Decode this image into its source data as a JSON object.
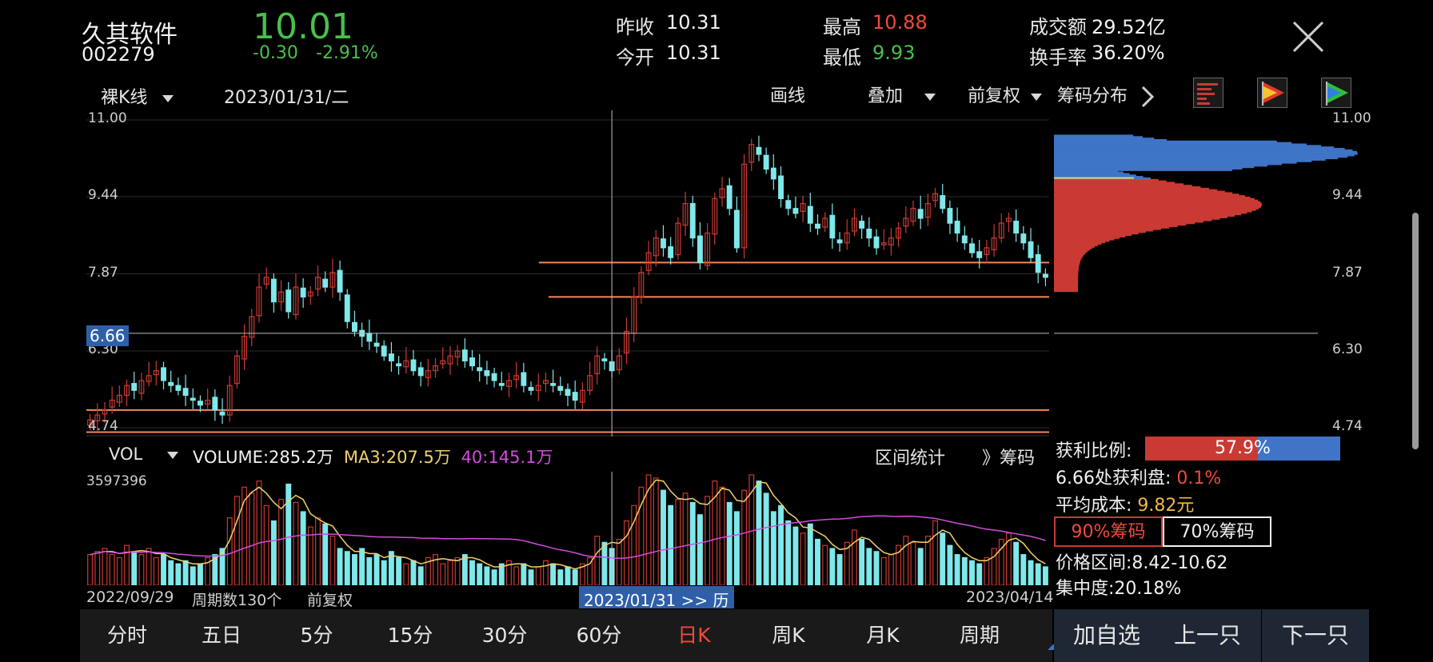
{
  "header": {
    "name": "久其软件",
    "code": "002279",
    "price": "10.01",
    "change": "-0.30",
    "change_pct": "-2.91%",
    "prev_close_label": "昨收",
    "prev_close": "10.31",
    "open_label": "今开",
    "open": "10.31",
    "high_label": "最高",
    "high": "10.88",
    "low_label": "最低",
    "low": "9.93",
    "amount_label": "成交额",
    "amount": "29.52亿",
    "turnover_label": "换手率",
    "turnover": "36.20%"
  },
  "toolbar": {
    "kline_type": "裸K线",
    "date": "2023/01/31/二",
    "draw": "画线",
    "overlay": "叠加",
    "adjust": "前复权",
    "chip_dist": "筹码分布"
  },
  "main_axis": {
    "labels": [
      "11.00",
      "9.44",
      "7.87",
      "6.30",
      "4.74"
    ]
  },
  "crosshair": {
    "price": "6.66",
    "date_label": "2023/01/31 >> 历"
  },
  "volume": {
    "indicator": "VOL",
    "volume_label": "VOLUME:",
    "volume": "285.2万",
    "ma3_label": "MA3:",
    "ma3": "207.5万",
    "ma40_label": "40:",
    "ma40": "145.1万",
    "range_stats": "区间统计",
    "chip_link": "》筹码",
    "max_label": "3597396",
    "start_date": "2022/09/29",
    "period_count": "周期数130个",
    "adjust_label": "前复权",
    "end_date": "2023/04/14"
  },
  "chip": {
    "axis_labels": [
      "11.00",
      "9.44",
      "7.87",
      "6.30",
      "4.74"
    ],
    "profit_label": "获利比例:",
    "profit_value": "57.9%",
    "profit_fraction": 0.579,
    "at_price_label": "6.66处获利盘:",
    "at_price_value": "0.1%",
    "avg_cost_label": "平均成本:",
    "avg_cost_value": "9.82元",
    "tab_90": "90%筹码",
    "tab_70": "70%筹码",
    "range_label": "价格区间:",
    "range_value": "8.42-10.62",
    "concentration_label": "集中度:",
    "concentration_value": "20.18%"
  },
  "periods": [
    "分时",
    "五日",
    "5分",
    "15分",
    "30分",
    "60分",
    "日K",
    "周K",
    "月K",
    "周期"
  ],
  "active_period": "日K",
  "actions": {
    "add": "加自选",
    "prev": "上一只",
    "next": "下一只"
  },
  "colors": {
    "up": "#c93a33",
    "down": "#7fe8ea",
    "green_text": "#49c04d",
    "red_text": "#f04a3d",
    "ma3": "#f0d26a",
    "ma40": "#d24dde",
    "chip_blue": "#3f74c6",
    "chip_red": "#c93a33",
    "level_line": "#f5875a"
  },
  "chart_data": {
    "type": "candlestick",
    "x_start": "2022/09/29",
    "x_end": "2023/04/14",
    "ylim": [
      4.74,
      11.0
    ],
    "horizontal_levels": [
      8.1,
      7.4,
      5.1,
      4.65
    ],
    "close": [
      4.9,
      5.0,
      5.1,
      5.3,
      5.4,
      5.6,
      5.5,
      5.7,
      5.8,
      5.9,
      5.7,
      5.6,
      5.5,
      5.4,
      5.3,
      5.2,
      5.3,
      5.1,
      5.0,
      5.6,
      6.2,
      6.6,
      7.0,
      7.6,
      7.8,
      7.3,
      7.5,
      7.1,
      7.6,
      7.4,
      7.5,
      7.8,
      7.6,
      7.9,
      7.5,
      6.9,
      6.7,
      6.6,
      6.5,
      6.4,
      6.2,
      6.1,
      6.0,
      6.1,
      5.9,
      5.8,
      5.9,
      6.0,
      6.1,
      6.2,
      6.3,
      6.1,
      6.0,
      5.9,
      5.8,
      5.7,
      5.6,
      5.7,
      5.8,
      5.6,
      5.5,
      5.6,
      5.7,
      5.6,
      5.5,
      5.4,
      5.3,
      5.5,
      5.8,
      6.2,
      6.1,
      5.9,
      6.2,
      6.7,
      7.4,
      7.9,
      8.3,
      8.6,
      8.4,
      8.2,
      8.9,
      9.3,
      8.6,
      8.1,
      8.7,
      9.4,
      9.6,
      9.2,
      8.4,
      10.1,
      10.5,
      10.3,
      10.0,
      9.8,
      9.4,
      9.2,
      9.1,
      9.3,
      8.9,
      8.8,
      9.0,
      8.6,
      8.5,
      8.7,
      9.0,
      8.8,
      8.6,
      8.4,
      8.5,
      8.6,
      8.8,
      9.0,
      9.2,
      9.0,
      9.3,
      9.5,
      9.2,
      8.9,
      8.7,
      8.5,
      8.3,
      8.2,
      8.4,
      8.6,
      8.9,
      9.0,
      8.7,
      8.5,
      8.2,
      7.9,
      7.8
    ],
    "volume": [
      1.0,
      1.1,
      1.2,
      1.0,
      0.9,
      1.3,
      1.1,
      1.0,
      1.2,
      0.9,
      1.0,
      0.8,
      0.7,
      0.8,
      0.6,
      0.7,
      0.9,
      1.0,
      1.2,
      2.2,
      2.9,
      3.2,
      3.0,
      3.4,
      2.6,
      2.1,
      2.8,
      3.3,
      2.7,
      2.4,
      1.9,
      2.2,
      2.0,
      1.6,
      1.2,
      1.1,
      1.0,
      1.2,
      0.9,
      1.0,
      0.8,
      1.1,
      0.9,
      0.7,
      0.8,
      0.6,
      0.9,
      1.0,
      0.7,
      0.8,
      0.9,
      1.0,
      0.8,
      0.7,
      0.6,
      0.5,
      0.7,
      0.8,
      0.6,
      0.7,
      0.5,
      0.6,
      0.8,
      0.7,
      0.5,
      0.6,
      0.5,
      0.7,
      0.9,
      1.6,
      1.4,
      1.2,
      1.5,
      2.1,
      2.6,
      3.2,
      3.6,
      3.5,
      3.1,
      2.6,
      2.8,
      3.0,
      2.7,
      2.3,
      2.9,
      3.4,
      3.2,
      2.7,
      2.4,
      3.1,
      3.6,
      3.4,
      3.0,
      2.4,
      2.6,
      2.1,
      1.9,
      1.7,
      2.0,
      1.5,
      1.3,
      1.2,
      1.0,
      1.4,
      1.8,
      1.5,
      1.2,
      1.1,
      0.9,
      1.0,
      1.3,
      1.6,
      1.4,
      1.2,
      1.6,
      2.1,
      1.7,
      1.3,
      1.0,
      0.9,
      0.8,
      0.7,
      0.9,
      1.2,
      1.5,
      1.7,
      1.4,
      1.0,
      0.8,
      0.7,
      0.6
    ]
  }
}
